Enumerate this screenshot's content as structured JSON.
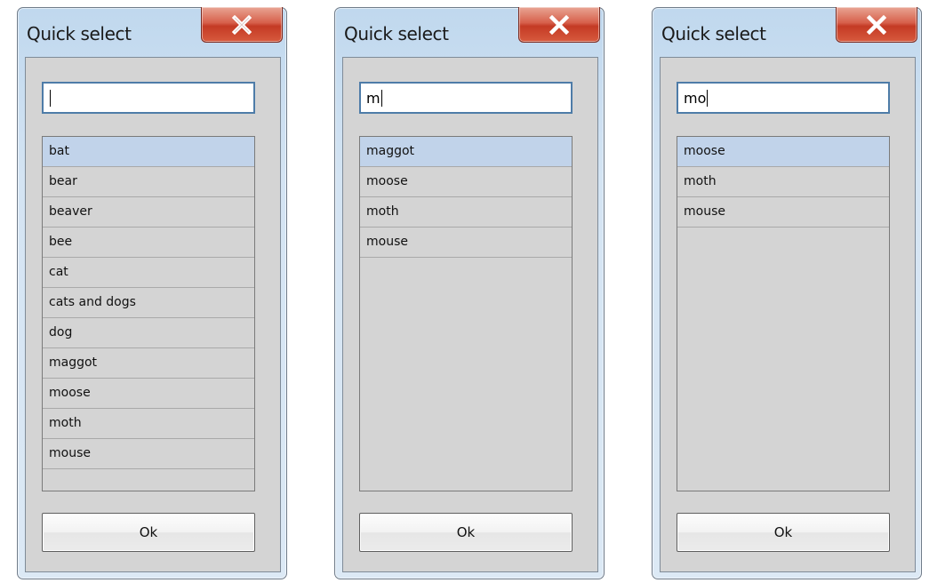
{
  "dialogs": [
    {
      "title": "Quick select",
      "search_value": "",
      "items": [
        "bat",
        "bear",
        "beaver",
        "bee",
        "cat",
        "cats and dogs",
        "dog",
        "maggot",
        "moose",
        "moth",
        "mouse",
        ""
      ],
      "selected_index": 0,
      "ok_label": "Ok",
      "close_icon": "close-icon"
    },
    {
      "title": "Quick select",
      "search_value": "m",
      "items": [
        "maggot",
        "moose",
        "moth",
        "mouse"
      ],
      "selected_index": 0,
      "ok_label": "Ok",
      "close_icon": "close-icon"
    },
    {
      "title": "Quick select",
      "search_value": "mo",
      "items": [
        "moose",
        "moth",
        "mouse"
      ],
      "selected_index": 0,
      "ok_label": "Ok",
      "close_icon": "close-icon"
    }
  ],
  "colors": {
    "selection": "#c1d3ea",
    "close_button": "#c43a24",
    "input_border": "#4e7ca8"
  }
}
